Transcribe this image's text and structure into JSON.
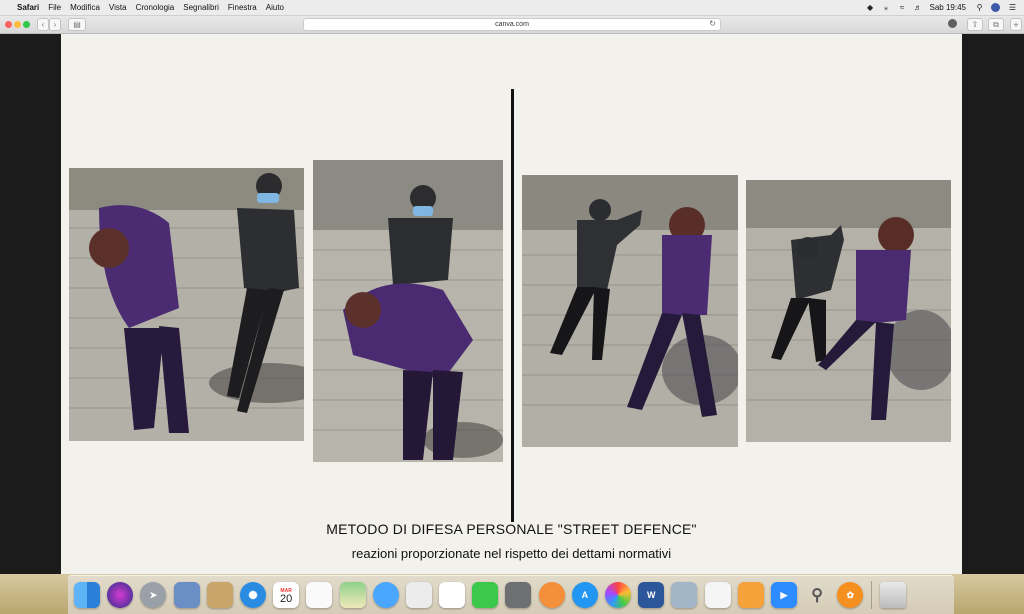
{
  "menubar": {
    "app_name": "Safari",
    "menus": [
      "File",
      "Modifica",
      "Vista",
      "Cronologia",
      "Segnalibri",
      "Finestra",
      "Aiuto"
    ],
    "clock": "Sab 19:45"
  },
  "toolbar": {
    "url": "canva.com"
  },
  "slide": {
    "title": "METODO DI DIFESA PERSONALE \"STREET DEFENCE\"",
    "subtitle": "reazioni proporzionate nel rispetto dei dettami normativi"
  },
  "dock": {
    "calendar_month": "MAR",
    "calendar_day": "20",
    "items": [
      "finder",
      "siri",
      "launchpad",
      "preview",
      "notes-book",
      "safari",
      "calendar",
      "reminders",
      "maps",
      "messages",
      "photos-edit",
      "numbers",
      "facetime",
      "system-preferences",
      "books",
      "app-store",
      "photos",
      "word",
      "image-capture",
      "textedit",
      "pages",
      "zoom",
      "keychain",
      "pinwheel",
      "trash"
    ]
  },
  "colors": {
    "slide_bg": "#f2f1ec",
    "menubar_bg": "#ececec",
    "dock_bg": "#d7c9a0"
  }
}
